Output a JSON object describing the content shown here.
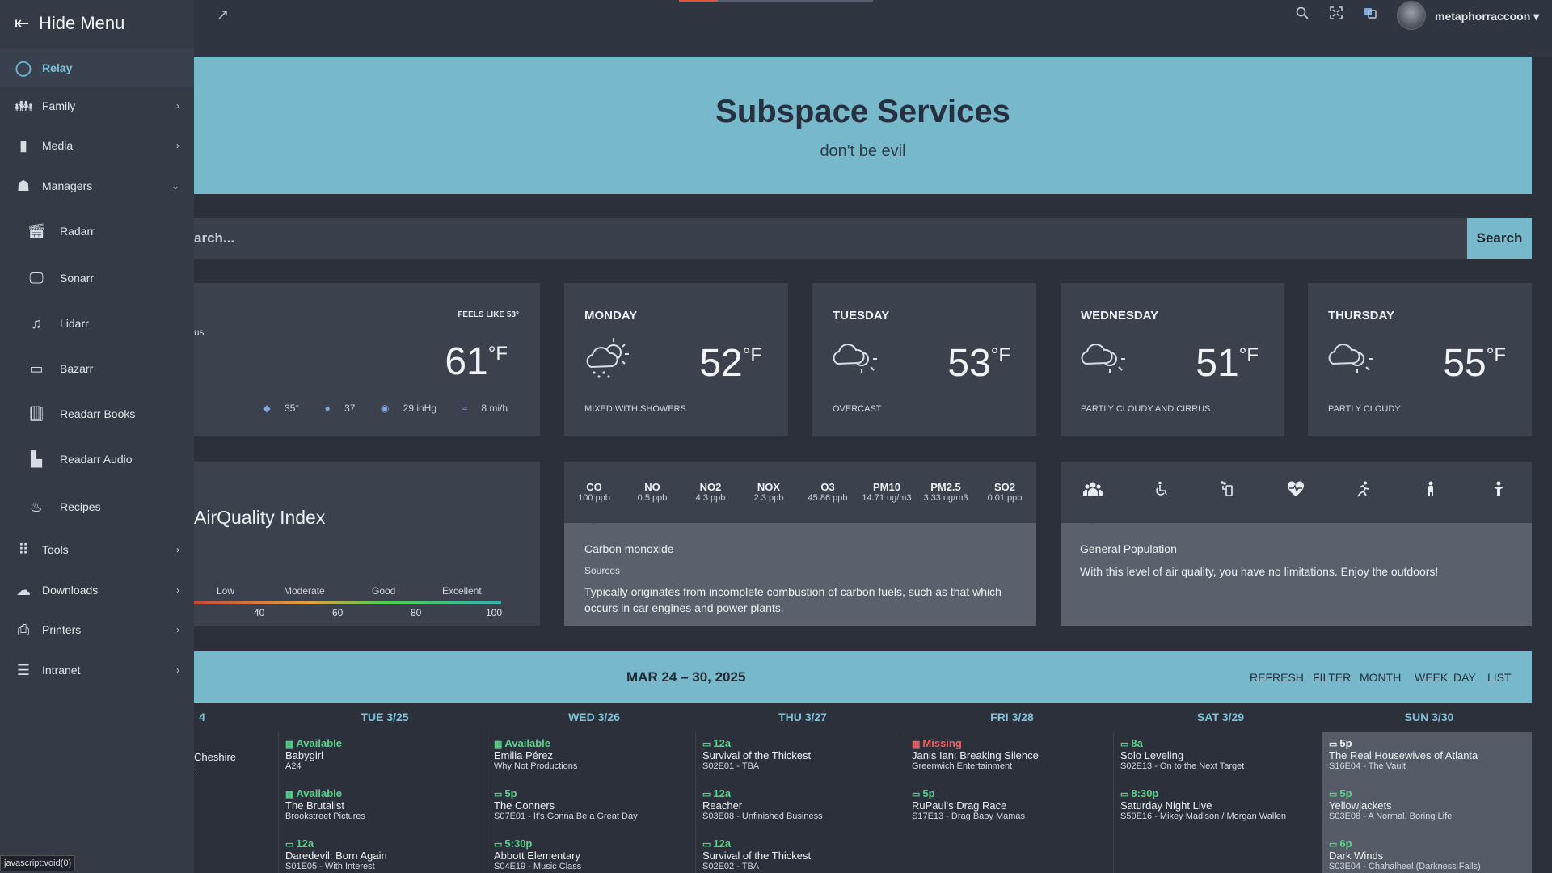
{
  "sidebar": {
    "hide_label": "Hide Menu",
    "items": [
      {
        "label": "Relay"
      },
      {
        "label": "Family"
      },
      {
        "label": "Media"
      },
      {
        "label": "Managers"
      },
      {
        "label": "Radarr"
      },
      {
        "label": "Sonarr"
      },
      {
        "label": "Lidarr"
      },
      {
        "label": "Bazarr"
      },
      {
        "label": "Readarr Books"
      },
      {
        "label": "Readarr Audio"
      },
      {
        "label": "Recipes"
      },
      {
        "label": "Tools"
      },
      {
        "label": "Downloads"
      },
      {
        "label": "Printers"
      },
      {
        "label": "Intranet"
      }
    ]
  },
  "topbar": {
    "username": "metaphorraccoon",
    "progress_fraction": 0.2
  },
  "hero": {
    "title": "Subspace Services",
    "subtitle": "don't be evil"
  },
  "search": {
    "placeholder": "arch...",
    "button_label": "Search"
  },
  "weather": {
    "current": {
      "feels_like": "FEELS LIKE 53°",
      "condition": "us",
      "temp": "61",
      "unit": "°F",
      "dew": "35°",
      "humidity": "37",
      "pressure": "29 inHg",
      "wind": "8 mi/h"
    },
    "days": [
      {
        "name": "MONDAY",
        "temp": "52",
        "unit": "°F",
        "desc": "MIXED WITH SHOWERS"
      },
      {
        "name": "TUESDAY",
        "temp": "53",
        "unit": "°F",
        "desc": "OVERCAST"
      },
      {
        "name": "WEDNESDAY",
        "temp": "51",
        "unit": "°F",
        "desc": "PARTLY CLOUDY AND CIRRUS"
      },
      {
        "name": "THURSDAY",
        "temp": "55",
        "unit": "°F",
        "desc": "PARTLY CLOUDY"
      }
    ]
  },
  "air": {
    "title": "AirQuality Index",
    "scale_labels": [
      "Low",
      "Moderate",
      "Good",
      "Excellent"
    ],
    "scale_numbers": [
      "40",
      "60",
      "80",
      "100"
    ],
    "pollutants": [
      {
        "name": "CO",
        "value": "100 ppb"
      },
      {
        "name": "NO",
        "value": "0.5 ppb"
      },
      {
        "name": "NO2",
        "value": "4.3 ppb"
      },
      {
        "name": "NOX",
        "value": "2.3 ppb"
      },
      {
        "name": "O3",
        "value": "45.86 ppb"
      },
      {
        "name": "PM10",
        "value": "14.71 ug/m3"
      },
      {
        "name": "PM2.5",
        "value": "3.33 ug/m3"
      },
      {
        "name": "SO2",
        "value": "0.01 ppb"
      }
    ],
    "selected_pollutant": "Carbon monoxide",
    "sources_label": "Sources",
    "pollutant_text": "Typically originates from incomplete combustion of carbon fuels, such as that which occurs in car engines and power plants.",
    "health_group": "General Population",
    "health_text": "With this level of air quality, you have no limitations. Enjoy the outdoors!"
  },
  "calendar": {
    "range": "MAR 24 – 30, 2025",
    "buttons": [
      "REFRESH",
      "FILTER",
      "MONTH",
      "WEEK",
      "DAY",
      "LIST"
    ],
    "day_headers": [
      "4",
      "TUE 3/25",
      "WED 3/26",
      "THU 3/27",
      "FRI 3/28",
      "SAT 3/29",
      "SUN 3/30"
    ],
    "columns": [
      {
        "events": [
          {
            "status": "",
            "title": "Cheshire",
            "sub": "."
          }
        ]
      },
      {
        "events": [
          {
            "status": "Available",
            "title": "Babygirl",
            "sub": "A24"
          },
          {
            "status": "Available",
            "title": "The Brutalist",
            "sub": "Brookstreet Pictures"
          },
          {
            "status": "12a",
            "title": "Daredevil: Born Again",
            "sub": "S01E05 - With Interest"
          }
        ]
      },
      {
        "events": [
          {
            "status": "Available",
            "title": "Emilia Pérez",
            "sub": "Why Not Productions"
          },
          {
            "status": "5p",
            "title": "The Conners",
            "sub": "S07E01 - It's Gonna Be a Great Day"
          },
          {
            "status": "5:30p",
            "title": "Abbott Elementary",
            "sub": "S04E19 - Music Class"
          }
        ]
      },
      {
        "events": [
          {
            "status": "12a",
            "title": "Survival of the Thickest",
            "sub": "S02E01 - TBA"
          },
          {
            "status": "12a",
            "title": "Reacher",
            "sub": "S03E08 - Unfinished Business"
          },
          {
            "status": "12a",
            "title": "Survival of the Thickest",
            "sub": "S02E02 - TBA"
          }
        ]
      },
      {
        "events": [
          {
            "status": "Missing",
            "title": "Janis Ian: Breaking Silence",
            "sub": "Greenwich Entertainment"
          },
          {
            "status": "5p",
            "title": "RuPaul's Drag Race",
            "sub": "S17E13 - Drag Baby Mamas"
          }
        ]
      },
      {
        "events": [
          {
            "status": "8a",
            "title": "Solo Leveling",
            "sub": "S02E13 - On to the Next Target"
          },
          {
            "status": "8:30p",
            "title": "Saturday Night Live",
            "sub": "S50E16 - Mikey Madison / Morgan Wallen"
          }
        ]
      },
      {
        "events": [
          {
            "status": "5p",
            "title": "The Real Housewives of Atlanta",
            "sub": "S16E04 - The Vault"
          },
          {
            "status": "5p",
            "title": "Yellowjackets",
            "sub": "S03E08 - A Normal, Boring Life"
          },
          {
            "status": "6p",
            "title": "Dark Winds",
            "sub": "S03E04 - Chahalheel (Darkness Falls)"
          }
        ]
      }
    ]
  },
  "statusbar": "javascript:void(0)"
}
